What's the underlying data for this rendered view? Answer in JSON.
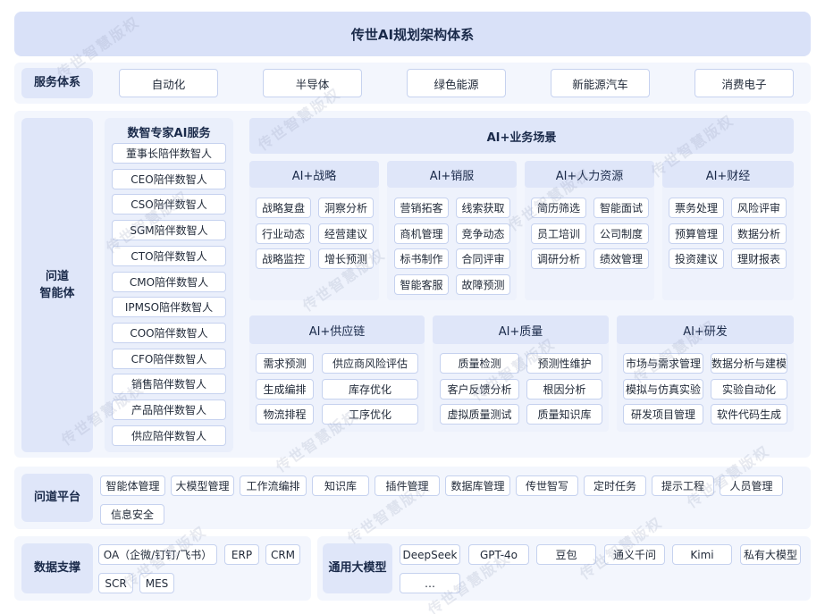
{
  "title": "传世AI规划架构体系",
  "service": {
    "label": "服务体系",
    "items": [
      "自动化",
      "半导体",
      "绿色能源",
      "新能源汽车",
      "消费电子"
    ]
  },
  "agent": {
    "label": "问道\n智能体",
    "experts": {
      "title": "数智专家AI服务",
      "items": [
        "董事长陪伴数智人",
        "CEO陪伴数智人",
        "CSO陪伴数智人",
        "SGM陪伴数智人",
        "CTO陪伴数智人",
        "CMO陪伴数智人",
        "IPMSO陪伴数智人",
        "COO陪伴数智人",
        "CFO陪伴数智人",
        "销售陪伴数智人",
        "产品陪伴数智人",
        "供应陪伴数智人"
      ]
    },
    "scenes": {
      "title": "AI+业务场景",
      "strategy": {
        "title": "AI+战略",
        "items": [
          "战略复盘",
          "洞察分析",
          "行业动态",
          "经营建议",
          "战略监控",
          "增长预测"
        ]
      },
      "sales": {
        "title": "AI+销服",
        "items": [
          "营销拓客",
          "线索获取",
          "商机管理",
          "竞争动态",
          "标书制作",
          "合同评审",
          "智能客服",
          "故障预测"
        ]
      },
      "hr": {
        "title": "AI+人力资源",
        "items": [
          "简历筛选",
          "智能面试",
          "员工培训",
          "公司制度",
          "调研分析",
          "绩效管理"
        ]
      },
      "finance": {
        "title": "AI+财经",
        "items": [
          "票务处理",
          "风险评审",
          "预算管理",
          "数据分析",
          "投资建议",
          "理财报表"
        ]
      },
      "supply": {
        "title": "AI+供应链",
        "items": [
          "需求预测",
          "供应商风险评估",
          "生成编排",
          "库存优化",
          "物流排程",
          "工序优化"
        ]
      },
      "quality": {
        "title": "AI+质量",
        "items": [
          "质量检测",
          "预测性维护",
          "客户反馈分析",
          "根因分析",
          "虚拟质量测试",
          "质量知识库"
        ]
      },
      "rd": {
        "title": "AI+研发",
        "items": [
          "市场与需求管理",
          "数据分析与建模",
          "模拟与仿真实验",
          "实验自动化",
          "研发项目管理",
          "软件代码生成"
        ]
      }
    }
  },
  "platform": {
    "label": "问道平台",
    "items": [
      "智能体管理",
      "大模型管理",
      "工作流编排",
      "知识库",
      "插件管理",
      "数据库管理",
      "传世智写",
      "定时任务",
      "提示工程",
      "人员管理",
      "信息安全"
    ]
  },
  "data_support": {
    "label": "数据支撑",
    "items": [
      "OA（企微/钉钉/飞书）",
      "ERP",
      "CRM",
      "SCR",
      "MES"
    ]
  },
  "models": {
    "label": "通用大模型",
    "items": [
      "DeepSeek",
      "GPT-4o",
      "豆包",
      "通义千问",
      "Kimi",
      "私有大模型",
      "…"
    ]
  },
  "watermark": "传世智慧版权"
}
